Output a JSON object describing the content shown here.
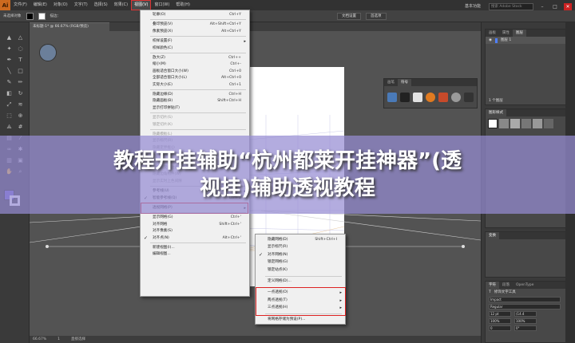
{
  "app": {
    "logo": "Ai",
    "brand_color": "#cc6a1f"
  },
  "menubar": {
    "items": [
      "文件(F)",
      "编辑(E)",
      "对象(O)",
      "文字(T)",
      "选择(S)",
      "效果(C)",
      "视图(V)",
      "窗口(W)",
      "帮助(H)"
    ],
    "active_index": 6,
    "workspace": "基本功能",
    "search_placeholder": "搜索 Adobe Stock"
  },
  "control_bar": {
    "selection": "未选择对象",
    "stroke_label": "描边：",
    "doc_setup": "文档设置",
    "prefs": "首选项"
  },
  "document_tab": "未标题-1* @ 66.67% (RGB/预览)",
  "view_menu": [
    {
      "label": "轮廓(O)",
      "shortcut": "Ctrl+Y"
    },
    {
      "sep": true
    },
    {
      "label": "叠印预览(V)",
      "shortcut": "Alt+Shift+Ctrl+Y"
    },
    {
      "label": "像素预览(X)",
      "shortcut": "Alt+Ctrl+Y"
    },
    {
      "sep": true
    },
    {
      "label": "校样设置(F)",
      "arrow": true
    },
    {
      "label": "校样颜色(C)"
    },
    {
      "sep": true
    },
    {
      "label": "放大(Z)",
      "shortcut": "Ctrl++"
    },
    {
      "label": "缩小(M)",
      "shortcut": "Ctrl+-"
    },
    {
      "label": "画板适合窗口大小(W)",
      "shortcut": "Ctrl+0"
    },
    {
      "label": "全部适合窗口大小(L)",
      "shortcut": "Alt+Ctrl+0"
    },
    {
      "label": "实际大小(E)",
      "shortcut": "Ctrl+1"
    },
    {
      "sep": true
    },
    {
      "label": "隐藏边缘(D)",
      "shortcut": "Ctrl+H"
    },
    {
      "label": "隐藏画板(B)",
      "shortcut": "Shift+Ctrl+H"
    },
    {
      "label": "显示打印拼贴(T)"
    },
    {
      "sep": true
    },
    {
      "label": "显示切片(S)",
      "dim": true
    },
    {
      "label": "锁定切片(K)",
      "dim": true
    },
    {
      "sep": true
    },
    {
      "label": "隐藏模板(L)",
      "dim": true
    },
    {
      "label": "显示标尺(R)",
      "dim": true
    },
    {
      "label": "隐藏定界框(J)",
      "dim": true
    },
    {
      "label": "显示透明度网格(Y)",
      "dim": true
    },
    {
      "label": "隐藏文本串接(H)",
      "dim": true
    },
    {
      "label": "隐藏渐变批注者",
      "dim": true
    },
    {
      "label": "隐藏边角构件(W)",
      "dim": true
    },
    {
      "label": "显示实时上色间隙",
      "dim": true
    },
    {
      "sep": true
    },
    {
      "label": "参考线(U)",
      "arrow": true
    },
    {
      "label": "智能参考线(Q)",
      "shortcut": "Ctrl+U",
      "checked": true
    },
    {
      "sep": true
    },
    {
      "label": "透视网格(P)",
      "arrow": true,
      "highlight": true
    },
    {
      "sep": true
    },
    {
      "label": "显示网格(G)",
      "shortcut": "Ctrl+'"
    },
    {
      "label": "对齐网格",
      "shortcut": "Shift+Ctrl+'"
    },
    {
      "label": "对齐像素(S)"
    },
    {
      "label": "对齐点(N)",
      "shortcut": "Alt+Ctrl+'",
      "checked": true
    },
    {
      "sep": true
    },
    {
      "label": "新建视图(I)..."
    },
    {
      "label": "编辑视图..."
    }
  ],
  "perspective_submenu": [
    {
      "label": "隐藏网格(D)",
      "shortcut": "Shift+Ctrl+I"
    },
    {
      "label": "显示标尺(R)"
    },
    {
      "label": "对齐网格(N)",
      "checked": true
    },
    {
      "label": "锁定网格(G)"
    },
    {
      "label": "锁定站点(K)"
    },
    {
      "sep": true
    },
    {
      "label": "定义网格(D)..."
    },
    {
      "sep": true
    },
    {
      "label": "一点透视(O)",
      "arrow": true
    },
    {
      "label": "两点透视(T)",
      "arrow": true
    },
    {
      "label": "三点透视(H)",
      "arrow": true
    },
    {
      "sep": true
    },
    {
      "label": "将网格存储为预设(P)..."
    }
  ],
  "right_panels": {
    "layers_tabs": [
      "画板",
      "属性",
      "图层"
    ],
    "layer_name": "图层 1",
    "layer_count": "1 个图层",
    "symbols_tabs": [
      "画笔",
      "符号"
    ],
    "graphic_styles_tab": "图形样式",
    "transform_tab": "变换",
    "char_tabs": [
      "字符",
      "段落",
      "OpenType"
    ],
    "touch_type": "修饰文字工具",
    "font_search": "Impact",
    "font_style": "Regular",
    "font_size": "12 pt",
    "leading": "(14.4",
    "tracking": "100%",
    "kerning": "100%",
    "baseline": "0",
    "rotation": "0°"
  },
  "status": {
    "zoom": "66.67%",
    "artboard": "1",
    "tool": "直接选择"
  },
  "banner": {
    "line1": "教程开挂辅助“杭州都莱开挂神器”(透",
    "line2": "视挂)辅助透视教程"
  }
}
